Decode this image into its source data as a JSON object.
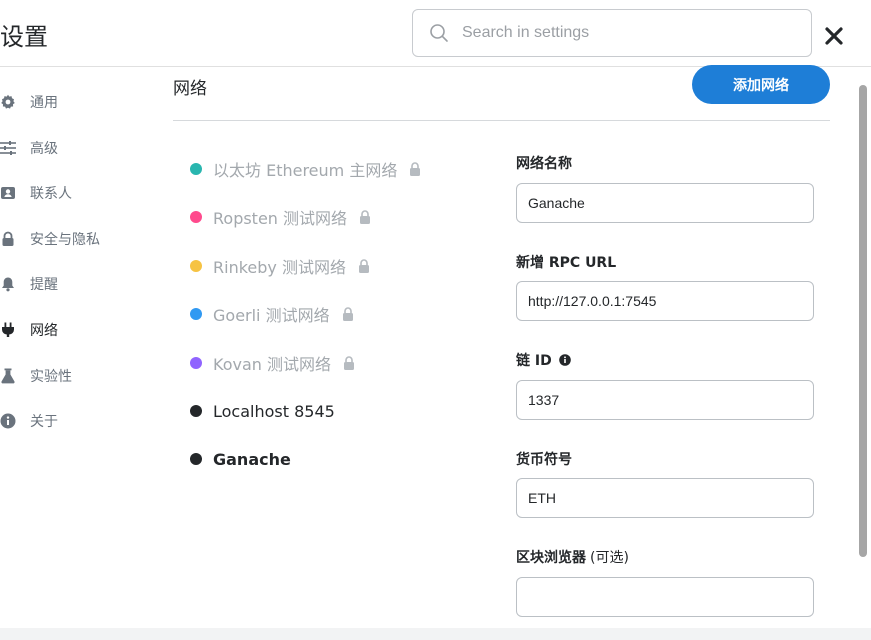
{
  "header": {
    "title": "设置",
    "search_placeholder": "Search in settings"
  },
  "sidebar": {
    "items": [
      {
        "label": "通用",
        "icon": "gear-icon"
      },
      {
        "label": "高级",
        "icon": "sliders-icon"
      },
      {
        "label": "联系人",
        "icon": "contact-card-icon"
      },
      {
        "label": "安全与隐私",
        "icon": "lock-icon"
      },
      {
        "label": "提醒",
        "icon": "bell-icon"
      },
      {
        "label": "网络",
        "icon": "plug-icon",
        "active": true
      },
      {
        "label": "实验性",
        "icon": "flask-icon"
      },
      {
        "label": "关于",
        "icon": "info-icon"
      }
    ]
  },
  "main": {
    "title": "网络",
    "add_button": "添加网络"
  },
  "networks": [
    {
      "name": "以太坊 Ethereum 主网络",
      "color": "#29b6af",
      "locked": true
    },
    {
      "name": "Ropsten 测试网络",
      "color": "#ff4a8d",
      "locked": true
    },
    {
      "name": "Rinkeby 测试网络",
      "color": "#f6c343",
      "locked": true
    },
    {
      "name": "Goerli 测试网络",
      "color": "#3099f2",
      "locked": true
    },
    {
      "name": "Kovan 测试网络",
      "color": "#9064ff",
      "locked": true
    },
    {
      "name": "Localhost 8545",
      "color": "#24272a",
      "locked": false
    },
    {
      "name": "Ganache",
      "color": "#24272a",
      "locked": false,
      "selected": true
    }
  ],
  "form": {
    "network_name_label": "网络名称",
    "network_name_value": "Ganache",
    "rpc_url_label": "新增 RPC URL",
    "rpc_url_value": "http://127.0.0.1:7545",
    "chain_id_label": "链 ID",
    "chain_id_value": "1337",
    "symbol_label": "货币符号",
    "symbol_value": "ETH",
    "explorer_label": "区块浏览器",
    "explorer_optional": "(可选)",
    "explorer_value": ""
  },
  "colors": {
    "accent": "#1e7ed7",
    "text_primary": "#24272a",
    "text_muted": "#6a737d"
  }
}
